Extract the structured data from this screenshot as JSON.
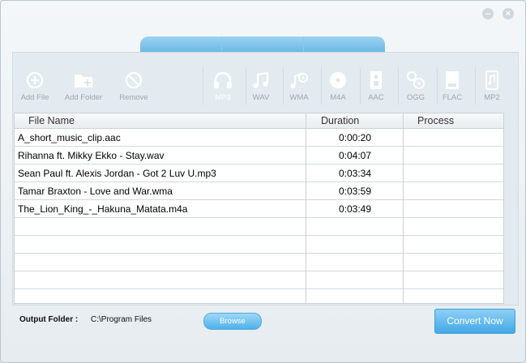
{
  "window": {
    "minimize_glyph": "–",
    "close_glyph": "×"
  },
  "toolbar": {
    "items": [
      {
        "label": "Add File",
        "icon": "add-file-icon"
      },
      {
        "label": "Add Folder",
        "icon": "add-folder-icon"
      },
      {
        "label": "Remove",
        "icon": "remove-icon"
      },
      {
        "label": "MP3",
        "icon": "headphones-icon"
      },
      {
        "label": "WAV",
        "icon": "music-notes-icon"
      },
      {
        "label": "WMA",
        "icon": "music-disc-icon"
      },
      {
        "label": "M4A",
        "icon": "cd-icon"
      },
      {
        "label": "AAC",
        "icon": "speaker-icon"
      },
      {
        "label": "OGG",
        "icon": "bubbles-icon"
      },
      {
        "label": "FLAC",
        "icon": "document-icon"
      },
      {
        "label": "MP2",
        "icon": "phone-icon"
      }
    ]
  },
  "table": {
    "headers": {
      "name": "File Name",
      "duration": "Duration",
      "process": "Process"
    },
    "rows": [
      {
        "name": "A_short_music_clip.aac",
        "duration": "0:00:20"
      },
      {
        "name": "Rihanna ft. Mikky Ekko - Stay.wav",
        "duration": "0:04:07"
      },
      {
        "name": "Sean Paul ft. Alexis Jordan - Got 2 Luv U.mp3",
        "duration": "0:03:34"
      },
      {
        "name": "Tamar Braxton - Love and War.wma",
        "duration": "0:03:59"
      },
      {
        "name": "The_Lion_King_-_Hakuna_Matata.m4a",
        "duration": "0:03:49"
      }
    ]
  },
  "footer": {
    "output_label": "Output Folder :",
    "output_path": "C:\\Program Files",
    "browse_label": "Browse",
    "convert_label": "Convert Now"
  },
  "colors": {
    "accent": "#4fb1eb",
    "tab": "#7cc2ea"
  }
}
